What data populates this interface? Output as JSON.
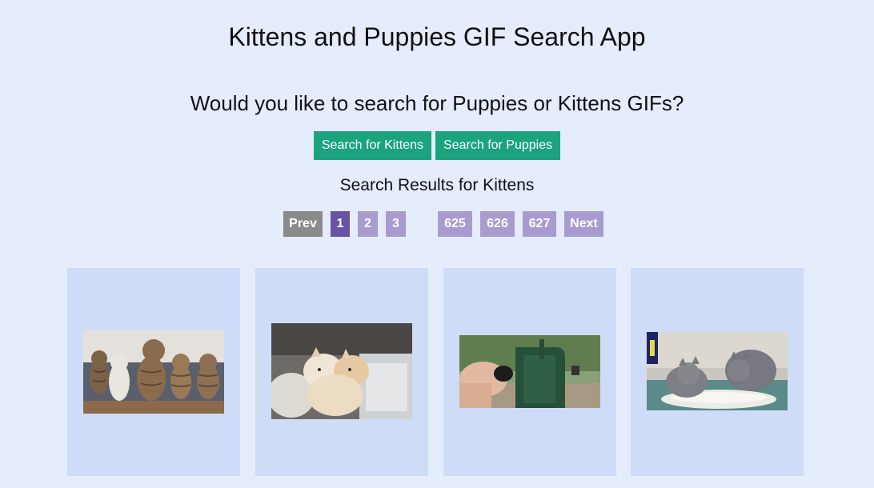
{
  "header": {
    "title": "Kittens and Puppies GIF Search App",
    "question": "Would you like to search for Puppies or Kittens GIFs?"
  },
  "search": {
    "kittens_label": "Search for Kittens",
    "puppies_label": "Search for Puppies"
  },
  "results": {
    "title": "Search Results for Kittens"
  },
  "pagination": {
    "prev": "Prev",
    "pages": [
      "1",
      "2",
      "3",
      "625",
      "626",
      "627"
    ],
    "current": "1",
    "next": "Next"
  },
  "colors": {
    "background": "#e5ecfb",
    "search_button": "#1aa37d",
    "page_active": "#6a53a5",
    "page_inactive": "#a99bcf",
    "prev_disabled": "#8a8a8a",
    "card": "#cfdcf8"
  }
}
